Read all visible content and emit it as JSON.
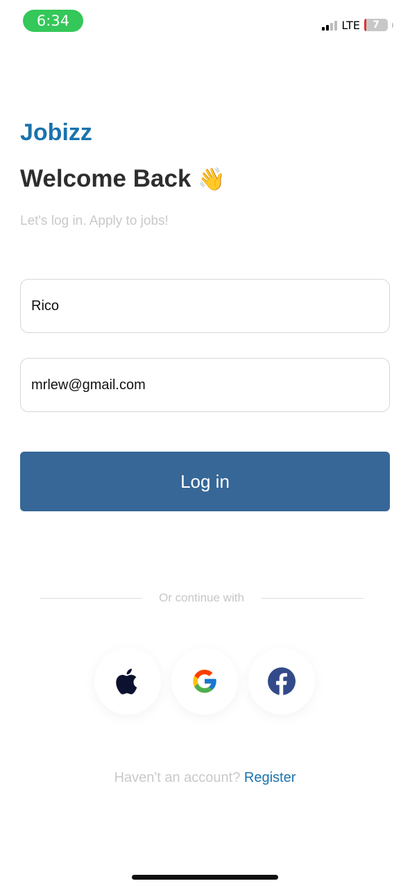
{
  "status_bar": {
    "time": "6:34",
    "network": "LTE",
    "battery": "7"
  },
  "brand": "Jobizz",
  "welcome": {
    "title": "Welcome Back",
    "emoji": "👋"
  },
  "subtitle": "Let's log in. Apply to jobs!",
  "form": {
    "name_value": "Rico",
    "email_value": "mrlew@gmail.com",
    "login_label": "Log in"
  },
  "divider_text": "Or continue with",
  "social": [
    {
      "icon": "apple-icon"
    },
    {
      "icon": "google-icon"
    },
    {
      "icon": "facebook-icon"
    }
  ],
  "register": {
    "prompt": "Haven't an account?",
    "link": "Register"
  },
  "colors": {
    "brand": "#1a73ad",
    "button": "#366797",
    "status_pill": "#34c759"
  }
}
